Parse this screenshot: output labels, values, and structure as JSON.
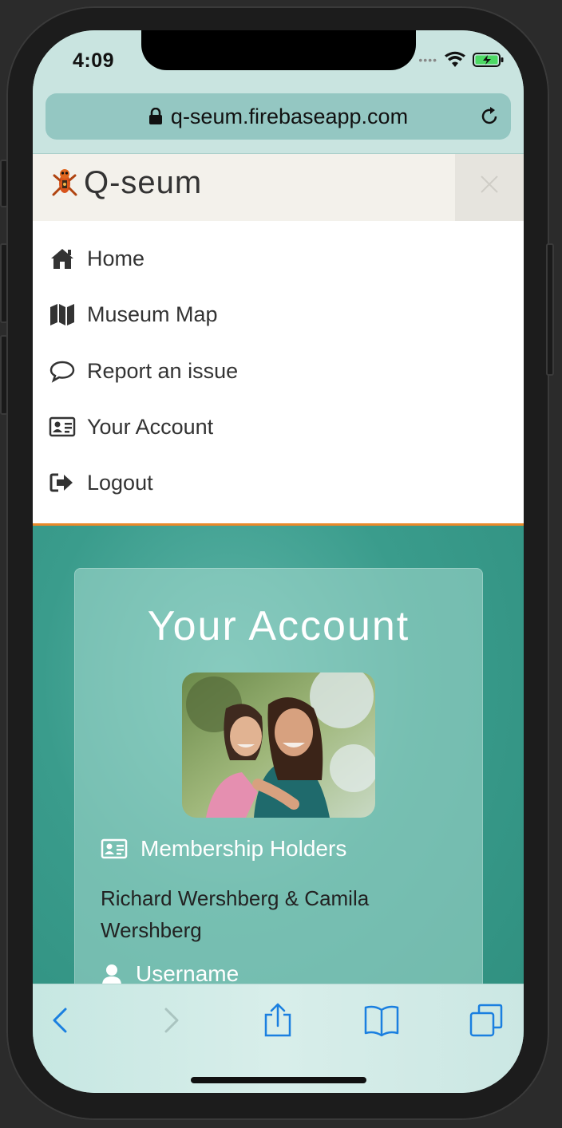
{
  "status_bar": {
    "time": "4:09"
  },
  "browser": {
    "url": "q-seum.firebaseapp.com"
  },
  "header": {
    "brand": "Q-seum"
  },
  "menu": {
    "items": [
      {
        "label": "Home",
        "icon": "home-icon"
      },
      {
        "label": "Museum Map",
        "icon": "map-icon"
      },
      {
        "label": "Report an issue",
        "icon": "comment-icon"
      },
      {
        "label": "Your Account",
        "icon": "id-card-icon"
      },
      {
        "label": "Logout",
        "icon": "logout-icon"
      }
    ]
  },
  "account": {
    "title": "Your Account",
    "membership_label": "Membership Holders",
    "holders": "Richard Wershberg & Camila Wershberg",
    "username_label": "Username"
  },
  "colors": {
    "accent_orange": "#e8892a",
    "teal_bg": "#3a9c8c",
    "ios_blue": "#1a7fe0"
  }
}
